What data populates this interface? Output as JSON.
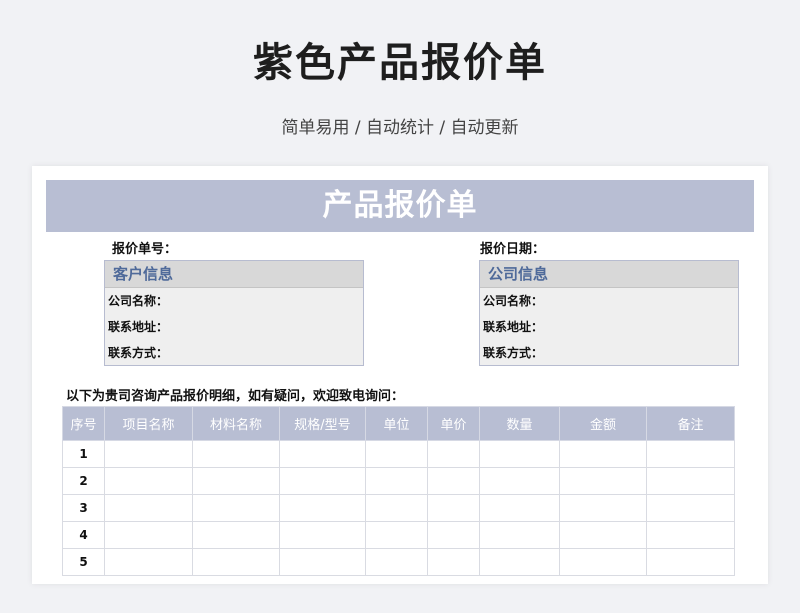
{
  "page": {
    "title": "紫色产品报价单",
    "subtitle": "简单易用 / 自动统计 / 自动更新"
  },
  "sheet": {
    "banner": "产品报价单",
    "quote_no_label": "报价单号：",
    "quote_date_label": "报价日期：",
    "customer": {
      "heading": "客户信息",
      "rows": [
        "公司名称：",
        "联系地址：",
        "联系方式："
      ]
    },
    "company": {
      "heading": "公司信息",
      "rows": [
        "公司名称：",
        "联系地址：",
        "联系方式："
      ]
    },
    "note": "以下为贵司咨询产品报价明细，如有疑问，欢迎致电询问：",
    "table": {
      "headers": [
        "序号",
        "项目名称",
        "材料名称",
        "规格/型号",
        "单位",
        "单价",
        "数量",
        "金额",
        "备注"
      ],
      "row_numbers": [
        "1",
        "2",
        "3",
        "4",
        "5"
      ]
    }
  },
  "colors": {
    "accent": "#b8bed3",
    "info_heading": "#4f6a9a",
    "page_bg": "#f1f2f5"
  }
}
